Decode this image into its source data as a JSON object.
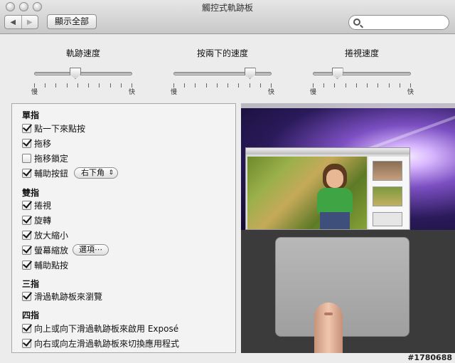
{
  "window": {
    "title": "觸控式軌跡板"
  },
  "toolbar": {
    "back": "◀",
    "forward": "▶",
    "show_all": "顯示全部",
    "search_placeholder": "",
    "search_value": ""
  },
  "sliders": [
    {
      "title": "軌跡速度",
      "low": "慢",
      "high": "快",
      "value": 0.42
    },
    {
      "title": "按兩下的速度",
      "low": "慢",
      "high": "快",
      "value": 0.78
    },
    {
      "title": "捲視速度",
      "low": "慢",
      "high": "快",
      "value": 0.25
    }
  ],
  "sections": {
    "one_finger": "單指",
    "two_fingers": "雙指",
    "three_fingers": "三指",
    "four_fingers": "四指"
  },
  "options": {
    "tap_to_click": {
      "label": "點一下來點按",
      "checked": true
    },
    "dragging": {
      "label": "拖移",
      "checked": true
    },
    "drag_lock": {
      "label": "拖移鎖定",
      "checked": false
    },
    "secondary_button": {
      "label": "輔助按鈕",
      "checked": true,
      "popup": "右下角"
    },
    "scroll": {
      "label": "捲視",
      "checked": true
    },
    "rotate": {
      "label": "旋轉",
      "checked": true
    },
    "pinch_zoom": {
      "label": "放大縮小",
      "checked": true
    },
    "screen_zoom": {
      "label": "螢幕縮放",
      "checked": true,
      "button": "選項⋯"
    },
    "secondary_click": {
      "label": "輔助點按",
      "checked": true
    },
    "swipe_browse": {
      "label": "滑過軌跡板來瀏覽",
      "checked": true
    },
    "expose": {
      "label": "向上或向下滑過軌跡板來啟用 Exposé",
      "checked": true
    },
    "switch_apps": {
      "label": "向右或向左滑過軌跡板來切換應用程式",
      "checked": true
    }
  },
  "watermark": "#1780688",
  "icons": {
    "search": "search-icon",
    "back": "chevron-left-icon",
    "forward": "chevron-right-icon"
  }
}
